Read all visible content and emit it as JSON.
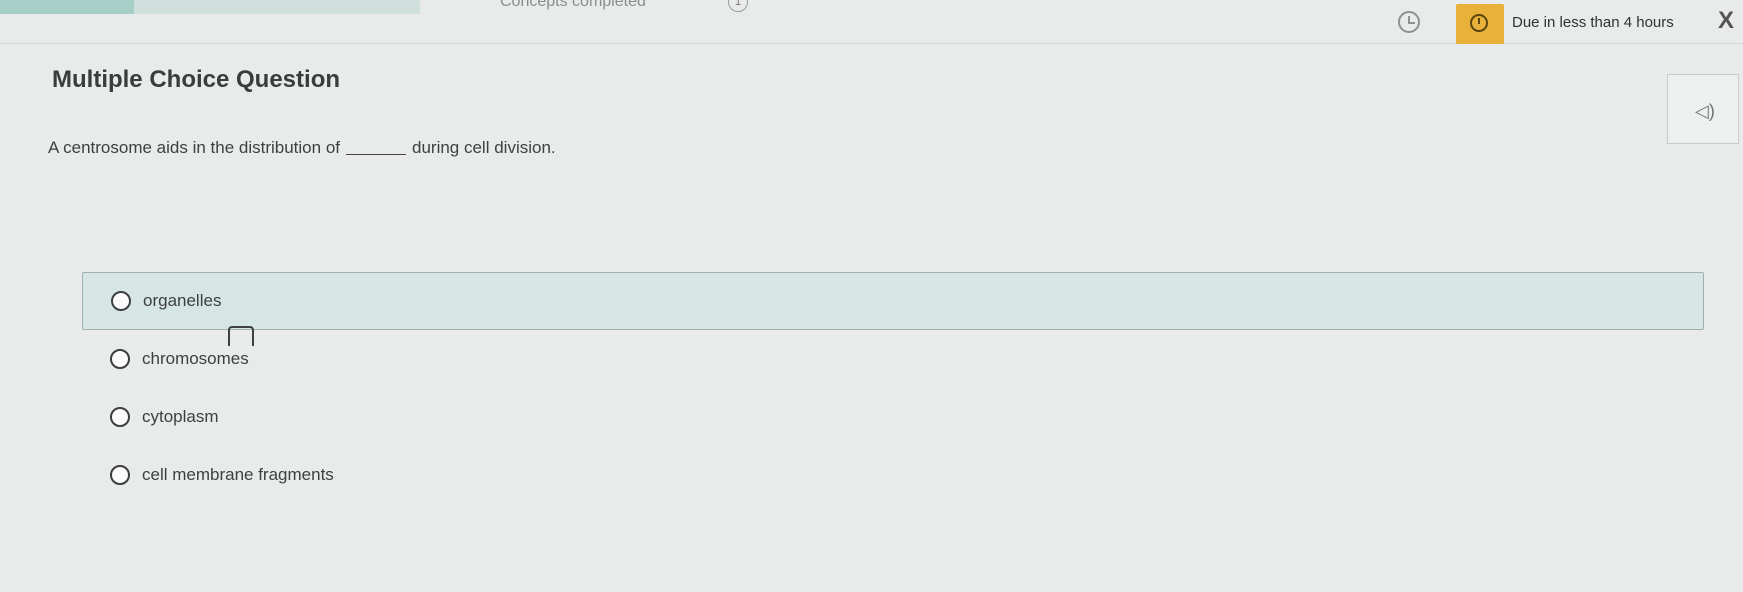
{
  "topbar": {
    "progress_fraction": 0.32,
    "concepts_status": "Concepts completed",
    "concept_counter": "1",
    "timer_icon": "timer-icon",
    "due_icon": "clock-icon",
    "due_text": "Due in less than 4 hours",
    "close_label": "X",
    "accent_color": "#e8b23a"
  },
  "question": {
    "type_label": "Multiple Choice Question",
    "text_before": "A centrosome aids in the distribution of",
    "text_after": "during cell division.",
    "read_aloud_icon": "speaker-icon"
  },
  "options": [
    {
      "label": "organelles",
      "highlighted": true
    },
    {
      "label": "chromosomes",
      "highlighted": false
    },
    {
      "label": "cytoplasm",
      "highlighted": false
    },
    {
      "label": "cell membrane fragments",
      "highlighted": false
    }
  ]
}
